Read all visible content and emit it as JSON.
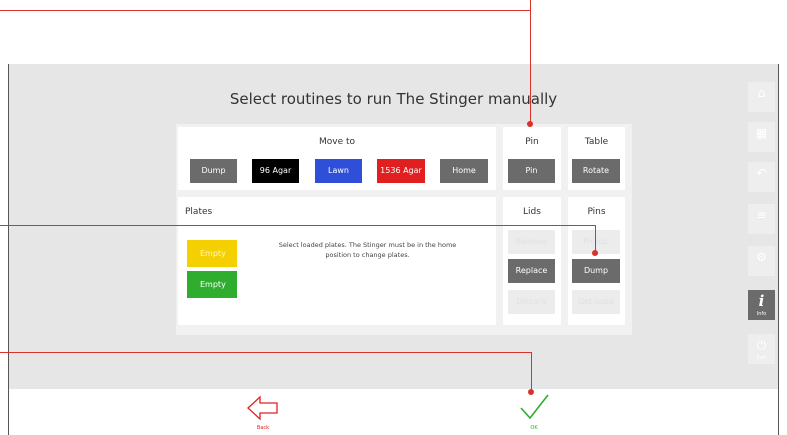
{
  "title": "Select routines to run The Stinger manually",
  "move_to": {
    "title": "Move to",
    "buttons": [
      {
        "label": "Dump"
      },
      {
        "label": "96 Agar"
      },
      {
        "label": "Lawn"
      },
      {
        "label": "1536 Agar"
      },
      {
        "label": "Home"
      }
    ]
  },
  "pin": {
    "title": "Pin",
    "button": "Pin"
  },
  "table": {
    "title": "Table",
    "button": "Rotate"
  },
  "plates": {
    "title": "Plates",
    "slots": [
      {
        "label": "Empty",
        "color": "#f5d000"
      },
      {
        "label": "Empty",
        "color": "#2fad2f"
      }
    ],
    "note_line1": "Select loaded plates. The Stinger must be in the home",
    "note_line2": "position to change plates."
  },
  "lids": {
    "title": "Lids",
    "buttons": [
      {
        "label": "Remove",
        "enabled": false
      },
      {
        "label": "Replace",
        "enabled": true
      },
      {
        "label": "Discard",
        "enabled": false
      }
    ]
  },
  "pins": {
    "title": "Pins",
    "buttons": [
      {
        "label": "Pickup",
        "enabled": false
      },
      {
        "label": "Dump",
        "enabled": true
      },
      {
        "label": "Get used",
        "enabled": false
      }
    ]
  },
  "sidebar": {
    "items": [
      {
        "icon": "home-icon",
        "label": ""
      },
      {
        "icon": "grid-icon",
        "label": ""
      },
      {
        "icon": "undo-icon",
        "label": ""
      },
      {
        "icon": "list-icon",
        "label": ""
      },
      {
        "icon": "settings-icon",
        "label": ""
      },
      {
        "icon": "info-icon",
        "label": "Info",
        "active": true
      },
      {
        "icon": "exit-icon",
        "label": "Exit"
      }
    ]
  },
  "footer": {
    "back_label": "Back",
    "ok_label": "OK"
  },
  "colors": {
    "accent_red": "#d8322b",
    "ok_green": "#2fad2f",
    "button_gray": "#6b6b6b"
  }
}
